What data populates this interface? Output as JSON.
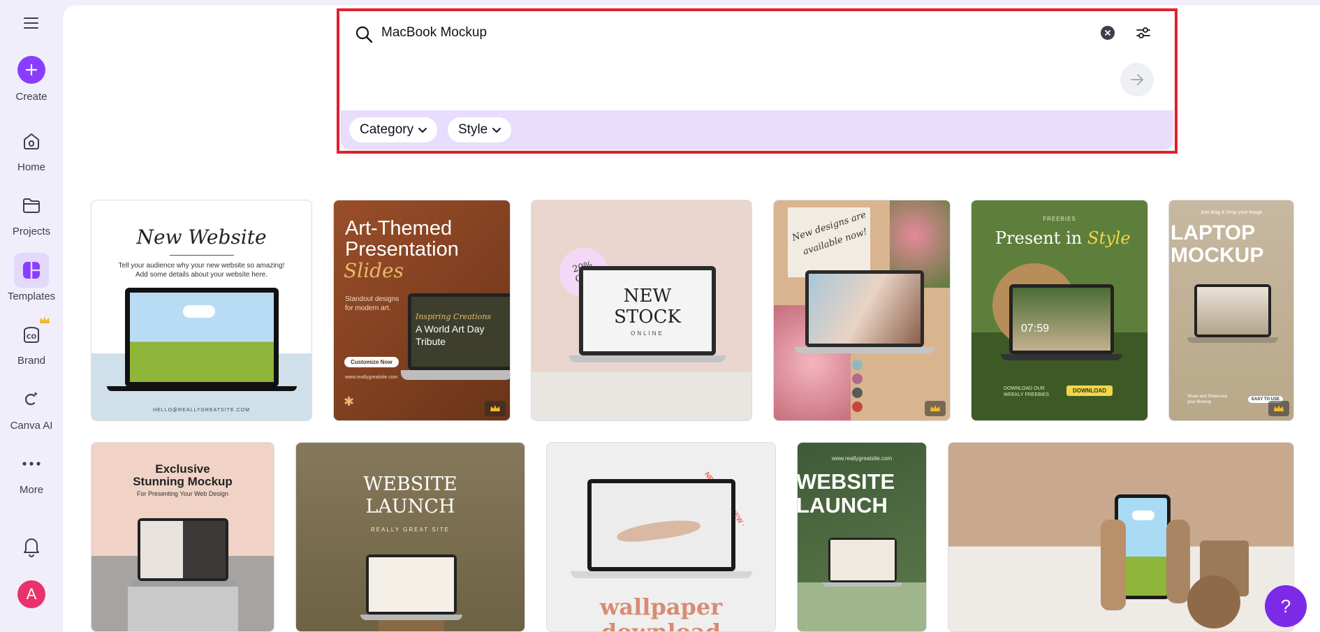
{
  "sidebar": {
    "items": [
      {
        "label": "Create"
      },
      {
        "label": "Home"
      },
      {
        "label": "Projects"
      },
      {
        "label": "Templates"
      },
      {
        "label": "Brand"
      },
      {
        "label": "Canva AI"
      },
      {
        "label": "More"
      }
    ],
    "avatar_letter": "A"
  },
  "search": {
    "value": "MacBook Mockup",
    "filters": [
      {
        "label": "Category"
      },
      {
        "label": "Style"
      }
    ]
  },
  "templates": {
    "card1": {
      "title": "New Website",
      "desc1": "Tell your audience why your new website so amazing!",
      "desc2": "Add some details about your website here.",
      "footer": "HELLO@REALLYGREATSITE.COM"
    },
    "card2": {
      "title1": "Art-Themed",
      "title2": "Presentation",
      "title3": "Slides",
      "sub1": "Standout designs",
      "sub2": "for modern art.",
      "button": "Customize Now",
      "site": "www.reallygreatsite.com",
      "screen1": "Inspiring Creations",
      "screen2": "A World Art Day",
      "screen3": "Tribute"
    },
    "card3": {
      "badge1": "20%",
      "badge2": "OFF",
      "title1": "NEW",
      "title2": "STOCK",
      "title3": "ONLINE"
    },
    "card4": {
      "script1": "New designs are",
      "script2": "available now!"
    },
    "card5": {
      "tag": "FREEBIES",
      "title1": "Present in",
      "title2": "Style",
      "time": "07:59",
      "footer1": "DOWNLOAD OUR",
      "footer2": "WEEKLY FREEBIES",
      "button": "DOWNLOAD"
    },
    "card6": {
      "tag": "Just drag & Drop your image",
      "title1": "LAPTOP",
      "title2": "MOCKUP",
      "footer1": "Share and Showcase",
      "footer2": "your Mockup",
      "button": "EASY TO USE"
    },
    "card7": {
      "title1": "Exclusive",
      "title2": "Stunning Mockup",
      "sub": "For Presenting Your Web Design"
    },
    "card8": {
      "title1": "WEBSITE",
      "title2": "LAUNCH",
      "sub": "REALLY GREAT SITE"
    },
    "card9": {
      "ring": "NEW · NEW · NEW ·",
      "title1": "wallpaper",
      "title2": "download"
    },
    "card10": {
      "site": "www.reallygreatsite.com",
      "title1": "WEBSITE",
      "title2": "LAUNCH"
    }
  },
  "help": {
    "label": "?"
  },
  "colors": {
    "accent": "#8b3dff",
    "highlight": "#e5202e",
    "chip_bar": "#e8ddfd"
  }
}
